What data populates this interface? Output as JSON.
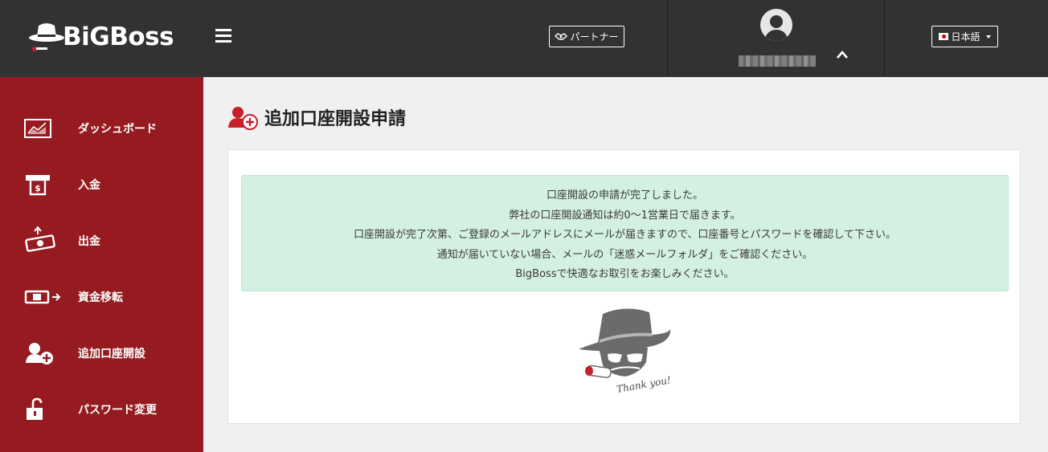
{
  "header": {
    "logo_text": "BiGBoss",
    "partner_label": "パートナー",
    "language_label": "日本語",
    "username": "●●●●●●●●"
  },
  "sidebar": {
    "items": [
      {
        "label": "ダッシュボード",
        "icon": "chart-icon"
      },
      {
        "label": "入金",
        "icon": "atm-deposit-icon"
      },
      {
        "label": "出金",
        "icon": "withdraw-icon"
      },
      {
        "label": "資金移転",
        "icon": "transfer-icon"
      },
      {
        "label": "追加口座開設",
        "icon": "add-user-icon"
      },
      {
        "label": "パスワード変更",
        "icon": "unlock-icon"
      }
    ]
  },
  "main": {
    "title": "追加口座開設申請",
    "alert_lines": [
      "口座開設の申請が完了しました。",
      "弊社の口座開設通知は約0～1営業日で届きます。",
      "口座開設が完了次第、ご登録のメールアドレスにメールが届きますので、口座番号とパスワードを確認して下さい。",
      "通知が届いていない場合、メールの「迷惑メールフォルダ」をご確認ください。",
      "BigBossで快適なお取引をお楽しみください。"
    ],
    "mascot_caption": "Thank you!"
  },
  "colors": {
    "topbar": "#323232",
    "sidebar": "#951b20",
    "alert_bg": "#d4f0e2",
    "accent": "#c8202a"
  }
}
